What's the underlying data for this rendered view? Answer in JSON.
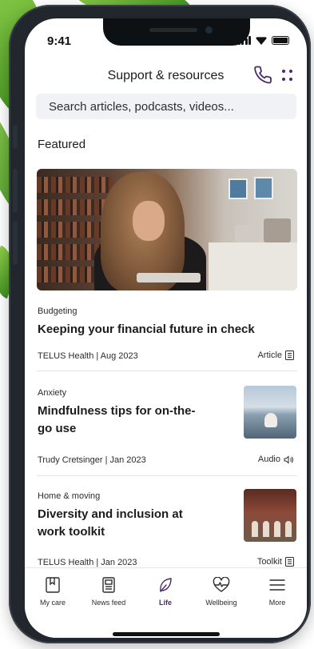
{
  "status": {
    "time": "9:41"
  },
  "header": {
    "title": "Support & resources"
  },
  "search": {
    "placeholder": "Search articles, podcasts, videos..."
  },
  "featured": {
    "section_title": "Featured",
    "category": "Budgeting",
    "title": "Keeping your financial future in check",
    "meta": "TELUS Health | Aug 2023",
    "type": "Article"
  },
  "cards": [
    {
      "category": "Anxiety",
      "title_lines": [
        "Mindfulness tips for on-the-",
        "go use"
      ],
      "meta": "Trudy Cretsinger | Jan 2023",
      "type": "Audio"
    },
    {
      "category": "Home & moving",
      "title_lines": [
        "Diversity and inclusion at",
        "work toolkit"
      ],
      "meta": "TELUS Health | Jan 2023",
      "type": "Toolkit"
    }
  ],
  "tabs": [
    {
      "label": "My care",
      "icon": "bookmark-icon"
    },
    {
      "label": "News feed",
      "icon": "news-feed-icon"
    },
    {
      "label": "Life",
      "icon": "leaf-icon",
      "active": true
    },
    {
      "label": "Wellbeing",
      "icon": "heart-pulse-icon"
    },
    {
      "label": "More",
      "icon": "menu-icon"
    }
  ],
  "colors": {
    "accent": "#4b286d",
    "text": "#1c1c1f",
    "search_bg": "#f1f2f6"
  }
}
